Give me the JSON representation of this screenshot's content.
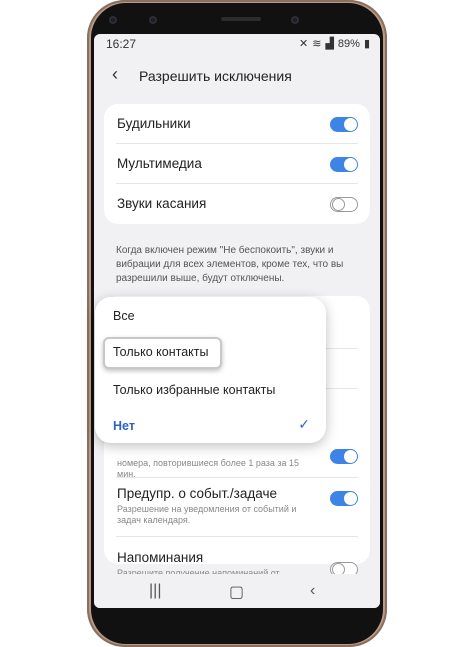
{
  "status": {
    "time": "16:27",
    "battery": "89%"
  },
  "appbar": {
    "back_icon": "chevron-left-icon",
    "title": "Разрешить исключения"
  },
  "toggles": [
    {
      "label": "Будильники",
      "on": true
    },
    {
      "label": "Мультимедиа",
      "on": true
    },
    {
      "label": "Звуки касания",
      "on": false
    }
  ],
  "description": "Когда включен режим \"Не беспокоить\", звуки и вибрации для всех элементов, кроме тех, что вы разрешили выше, будут отключены.",
  "repeat_row": {
    "subtitle": "номера, повторившиеся более 1 раза за 15 мин.",
    "on": true
  },
  "events_row": {
    "label": "Предупр. о событ./задаче",
    "subtitle": "Разрешение на уведомления от событий и задач календаря.",
    "on": true
  },
  "reminders_row": {
    "label": "Напоминания",
    "subtitle": "Разрешите получение напоминаний от",
    "on": false
  },
  "popup": {
    "options": [
      "Все",
      "Только контакты",
      "Только избранные контакты",
      "Нет"
    ],
    "selected": "Нет",
    "highlighted": "Только контакты"
  },
  "navbar": {
    "recent_icon": "recents-icon",
    "home_icon": "home-icon",
    "back_icon": "back-icon"
  },
  "colors": {
    "accent": "#3e84e6",
    "phone_frame": "#b99a86",
    "screen_bg": "#f1f1f3"
  }
}
